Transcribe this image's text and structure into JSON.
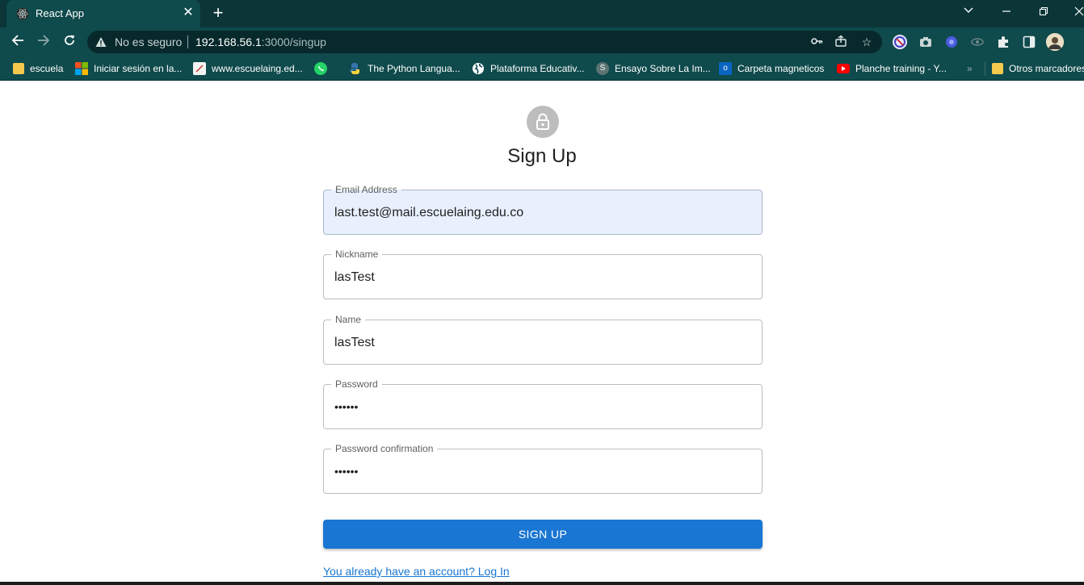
{
  "browser": {
    "tab": {
      "title": "React App",
      "favicon": "react-icon"
    },
    "window_controls": [
      "chevron-down-icon",
      "minimize-icon",
      "restore-icon",
      "close-icon"
    ],
    "address_bar": {
      "security_label": "No es seguro",
      "url_host": "192.168.56.1",
      "url_rest": ":3000/singup"
    },
    "bookmarks": [
      {
        "label": "escuela",
        "icon": "folder-icon"
      },
      {
        "label": "Iniciar sesión en la...",
        "icon": "microsoft-icon"
      },
      {
        "label": "www.escuelaing.ed...",
        "icon": "page-icon"
      },
      {
        "label": "",
        "icon": "whatsapp-icon"
      },
      {
        "label": "The Python Langua...",
        "icon": "python-icon"
      },
      {
        "label": "Plataforma Educativ...",
        "icon": "globe-icon"
      },
      {
        "label": "Ensayo Sobre La Im...",
        "icon": "s-icon"
      },
      {
        "label": "Carpeta magneticos",
        "icon": "outlook-icon"
      },
      {
        "label": "Planche training - Y...",
        "icon": "youtube-icon"
      },
      {
        "label": "»",
        "icon": ""
      },
      {
        "label": "Otros marcadores",
        "icon": "folder-icon"
      }
    ]
  },
  "form": {
    "title": "Sign Up",
    "fields": [
      {
        "label": "Email Address",
        "value": "last.test@mail.escuelaing.edu.co"
      },
      {
        "label": "Nickname",
        "value": "lasTest"
      },
      {
        "label": "Name",
        "value": "lasTest"
      },
      {
        "label": "Password",
        "value": "••••••"
      },
      {
        "label": "Password confirmation",
        "value": "••••••"
      }
    ],
    "submit_label": "SIGN UP",
    "login_link": "You already have an account? Log In"
  },
  "colors": {
    "primary": "#1976d2",
    "chrome_frame": "#0f4a4c",
    "autofill_bg": "#e8f0fe"
  }
}
